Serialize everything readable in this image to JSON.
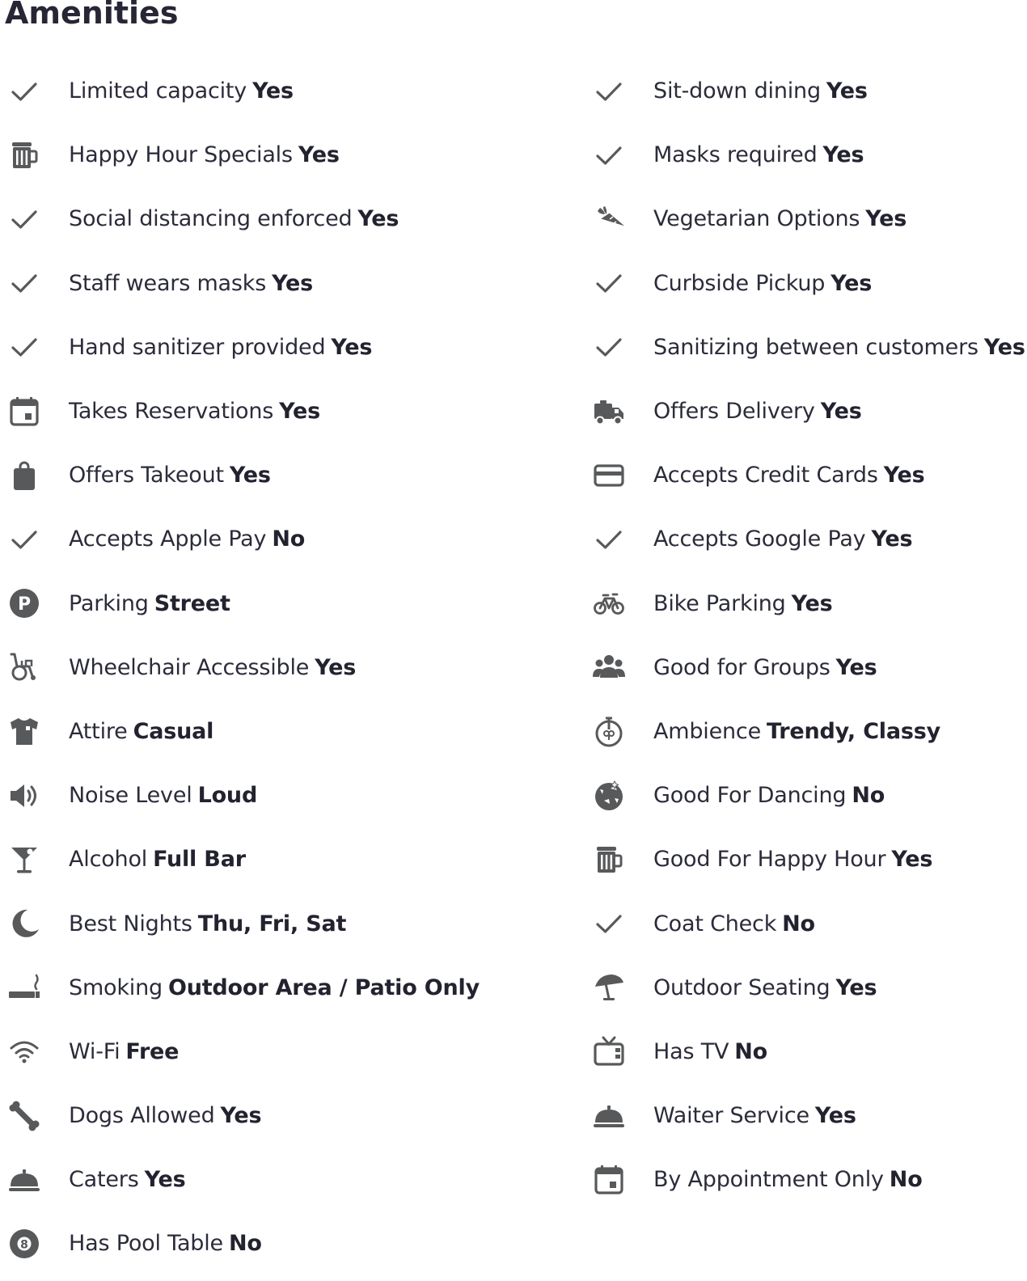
{
  "title": "Amenities",
  "icon_color": "#58595b",
  "amenities": [
    {
      "label": "Limited capacity",
      "value": "Yes",
      "icon": "check-icon"
    },
    {
      "label": "Sit-down dining",
      "value": "Yes",
      "icon": "check-icon"
    },
    {
      "label": "Happy Hour Specials",
      "value": "Yes",
      "icon": "beer-mug-icon"
    },
    {
      "label": "Masks required",
      "value": "Yes",
      "icon": "check-icon"
    },
    {
      "label": "Social distancing enforced",
      "value": "Yes",
      "icon": "check-icon"
    },
    {
      "label": "Vegetarian Options",
      "value": "Yes",
      "icon": "carrot-icon"
    },
    {
      "label": "Staff wears masks",
      "value": "Yes",
      "icon": "check-icon"
    },
    {
      "label": "Curbside Pickup",
      "value": "Yes",
      "icon": "check-icon"
    },
    {
      "label": "Hand sanitizer provided",
      "value": "Yes",
      "icon": "check-icon"
    },
    {
      "label": "Sanitizing between customers",
      "value": "Yes",
      "icon": "check-icon"
    },
    {
      "label": "Takes Reservations",
      "value": "Yes",
      "icon": "calendar-icon"
    },
    {
      "label": "Offers Delivery",
      "value": "Yes",
      "icon": "delivery-truck-icon"
    },
    {
      "label": "Offers Takeout",
      "value": "Yes",
      "icon": "shopping-bag-icon"
    },
    {
      "label": "Accepts Credit Cards",
      "value": "Yes",
      "icon": "credit-card-icon"
    },
    {
      "label": "Accepts Apple Pay",
      "value": "No",
      "icon": "check-icon"
    },
    {
      "label": "Accepts Google Pay",
      "value": "Yes",
      "icon": "check-icon"
    },
    {
      "label": "Parking",
      "value": "Street",
      "icon": "parking-icon"
    },
    {
      "label": "Bike Parking",
      "value": "Yes",
      "icon": "bicycle-icon"
    },
    {
      "label": "Wheelchair Accessible",
      "value": "Yes",
      "icon": "wheelchair-icon"
    },
    {
      "label": "Good for Groups",
      "value": "Yes",
      "icon": "group-icon"
    },
    {
      "label": "Attire",
      "value": "Casual",
      "icon": "shirt-icon"
    },
    {
      "label": "Ambience",
      "value": "Trendy, Classy",
      "icon": "ambience-icon"
    },
    {
      "label": "Noise Level",
      "value": "Loud",
      "icon": "speaker-icon"
    },
    {
      "label": "Good For Dancing",
      "value": "No",
      "icon": "disco-ball-icon"
    },
    {
      "label": "Alcohol",
      "value": "Full Bar",
      "icon": "cocktail-icon"
    },
    {
      "label": "Good For Happy Hour",
      "value": "Yes",
      "icon": "beer-mug-icon"
    },
    {
      "label": "Best Nights",
      "value": "Thu, Fri, Sat",
      "icon": "moon-icon"
    },
    {
      "label": "Coat Check",
      "value": "No",
      "icon": "check-icon"
    },
    {
      "label": "Smoking",
      "value": "Outdoor Area / Patio Only",
      "icon": "cigarette-icon"
    },
    {
      "label": "Outdoor Seating",
      "value": "Yes",
      "icon": "umbrella-icon"
    },
    {
      "label": "Wi-Fi",
      "value": "Free",
      "icon": "wifi-icon"
    },
    {
      "label": "Has TV",
      "value": "No",
      "icon": "tv-icon"
    },
    {
      "label": "Dogs Allowed",
      "value": "Yes",
      "icon": "bone-icon"
    },
    {
      "label": "Waiter Service",
      "value": "Yes",
      "icon": "cloche-icon"
    },
    {
      "label": "Caters",
      "value": "Yes",
      "icon": "cloche-icon"
    },
    {
      "label": "By Appointment Only",
      "value": "No",
      "icon": "calendar-icon"
    },
    {
      "label": "Has Pool Table",
      "value": "No",
      "icon": "pool-ball-icon"
    }
  ]
}
